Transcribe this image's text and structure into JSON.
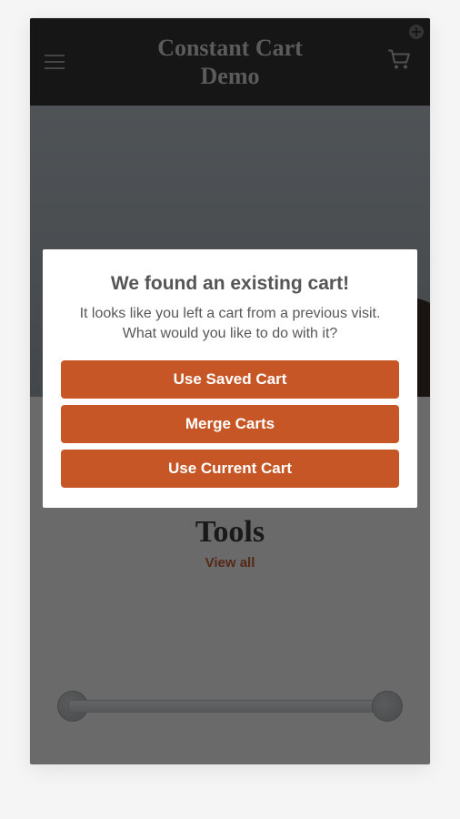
{
  "header": {
    "title": "Constant Cart Demo"
  },
  "section": {
    "heading": "Tools",
    "link": "View all"
  },
  "modal": {
    "title": "We found an existing cart!",
    "message": "It looks like you left a cart from a previous visit. What would you like to do with it?",
    "buttons": {
      "saved": "Use Saved Cart",
      "merge": "Merge Carts",
      "current": "Use Current Cart"
    }
  }
}
